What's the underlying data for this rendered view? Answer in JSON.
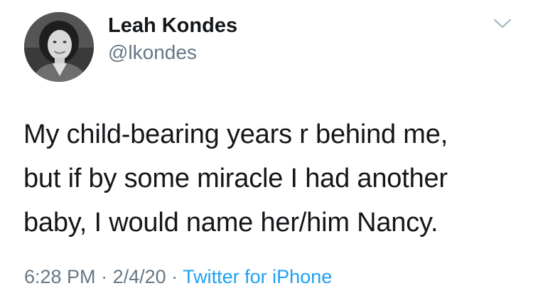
{
  "user": {
    "display_name": "Leah Kondes",
    "handle": "@lkondes",
    "avatar_icon": "profile-photo"
  },
  "menu": {
    "icon": "chevron-down-icon"
  },
  "tweet": {
    "lines": [
      "My child-bearing years r behind me,",
      "but if by some miracle I had another",
      "baby, I would name her/him Nancy."
    ]
  },
  "meta": {
    "time": "6:28 PM",
    "sep1": " · ",
    "date": "2/4/20",
    "sep2": " · ",
    "source": "Twitter for iPhone"
  },
  "colors": {
    "text": "#14171a",
    "secondary": "#657786",
    "link": "#1da1f2"
  }
}
